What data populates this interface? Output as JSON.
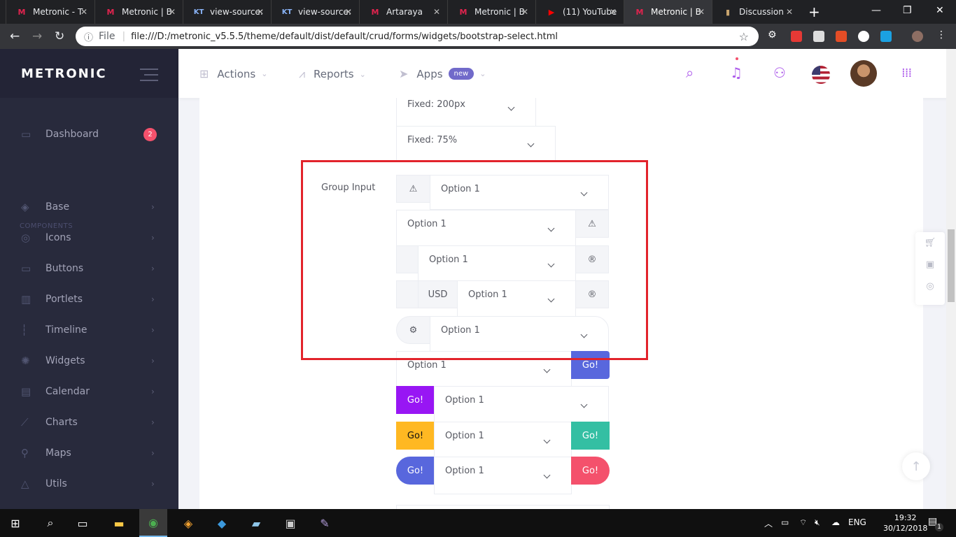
{
  "browser": {
    "tabs": [
      {
        "title": "Metronic - T",
        "icon": "M"
      },
      {
        "title": "Metronic | B",
        "icon": "M"
      },
      {
        "title": "view-source:",
        "icon": "KT"
      },
      {
        "title": "view-source:",
        "icon": "KT"
      },
      {
        "title": "Artaraya",
        "icon": "M"
      },
      {
        "title": "Metronic | B",
        "icon": "M"
      },
      {
        "title": "(11) YouTube",
        "icon": "▶"
      },
      {
        "title": "Metronic | B",
        "icon": "M"
      },
      {
        "title": "Discussion",
        "icon": "▮"
      }
    ],
    "url_prefix": "File",
    "url": "file:///D:/metronic_v5.5.5/theme/default/dist/default/crud/forms/widgets/bootstrap-select.html"
  },
  "sidebar": {
    "brand": "METRONIC",
    "dashboard": {
      "label": "Dashboard",
      "badge": "2"
    },
    "section": "COMPONENTS",
    "items": [
      "Base",
      "Icons",
      "Buttons",
      "Portlets",
      "Timeline",
      "Widgets",
      "Calendar",
      "Charts",
      "Maps",
      "Utils"
    ]
  },
  "header": {
    "menu": [
      {
        "label": "Actions"
      },
      {
        "label": "Reports"
      },
      {
        "label": "Apps",
        "badge": "new"
      }
    ]
  },
  "form": {
    "fixed_200": "Fixed: 200px",
    "fixed_75": "Fixed: 75%",
    "group_label": "Group Input",
    "option": "Option 1",
    "usd": "USD",
    "go": "Go!"
  },
  "colors": {
    "go_primary": "#5867dd",
    "go_purple": "#9816f4",
    "go_warning": "#ffb822",
    "go_success": "#34bfa3",
    "go_danger": "#f4516c",
    "highlight": "#e2232b"
  },
  "taskbar": {
    "lang": "ENG",
    "time": "19:32",
    "date": "30/12/2018",
    "notif": "1"
  }
}
